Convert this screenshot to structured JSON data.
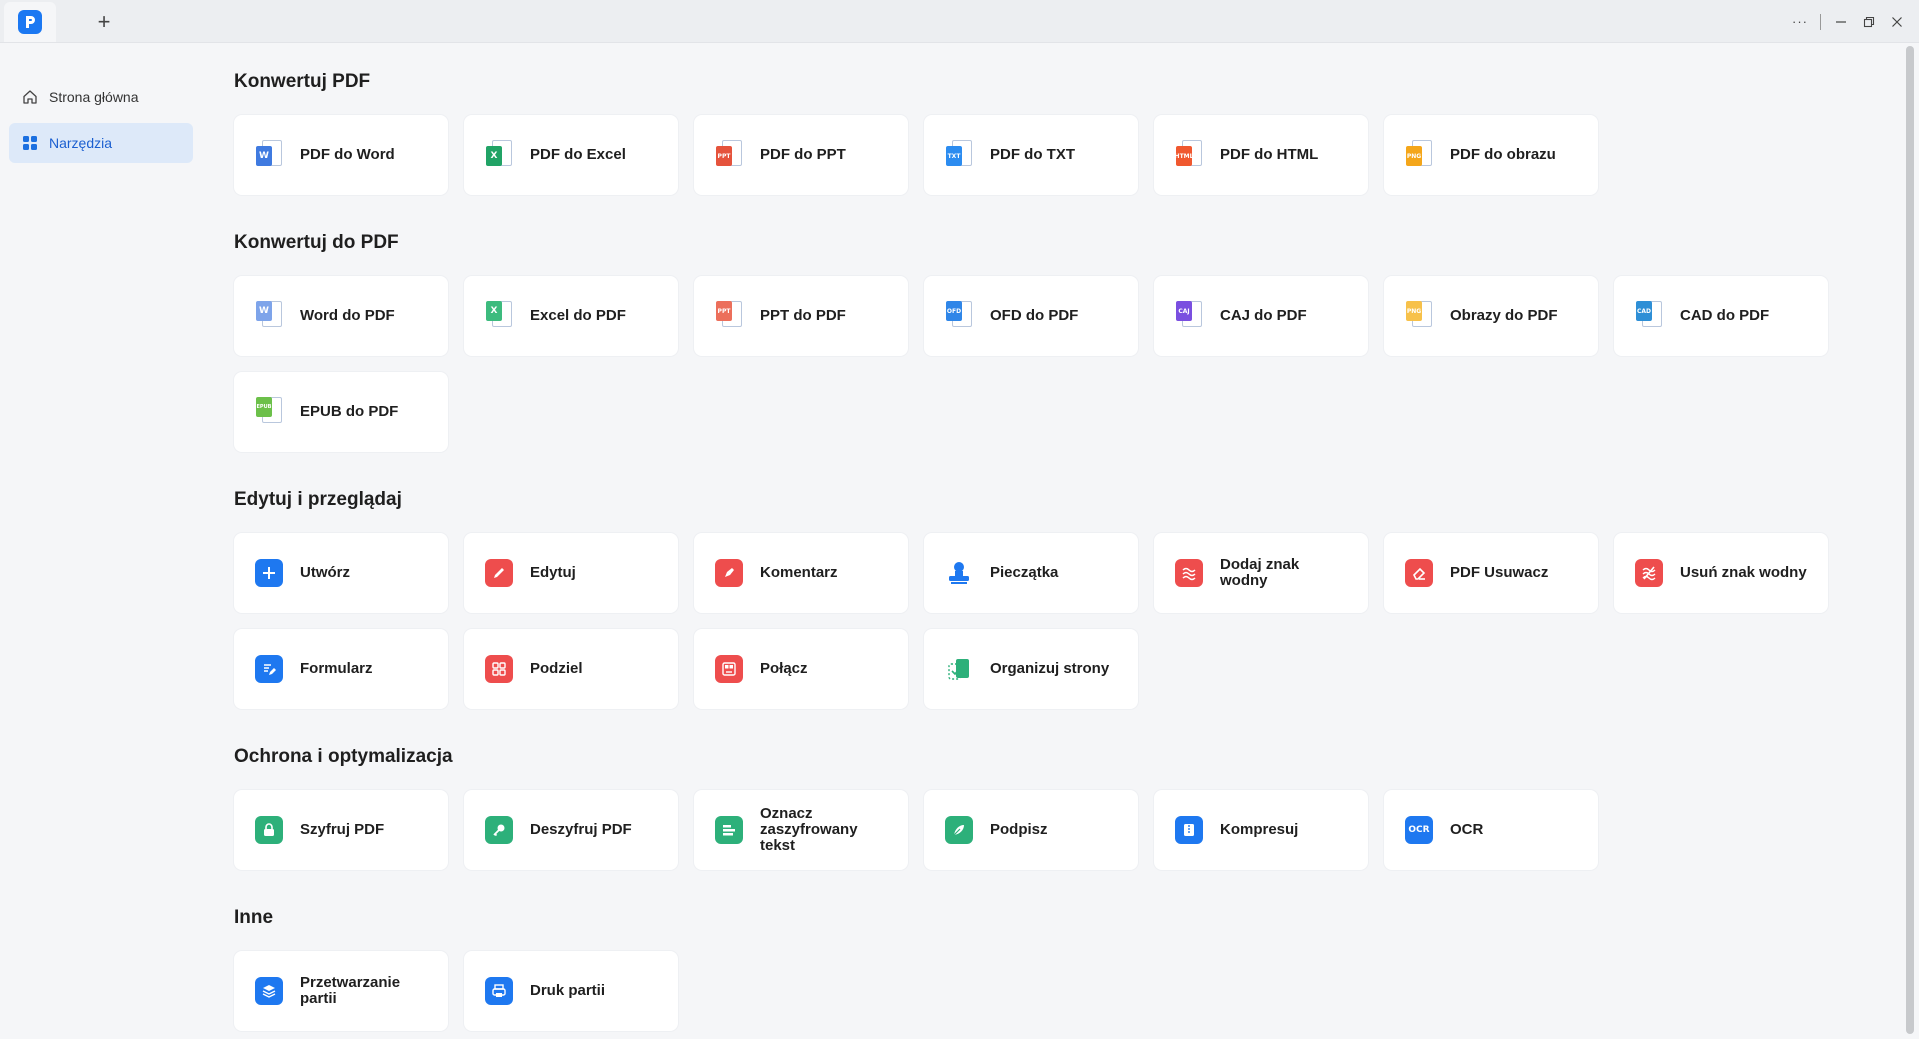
{
  "app": {
    "new_tab_label": "+",
    "window_menu_label": "···"
  },
  "sidebar": {
    "items": [
      {
        "label": "Strona główna",
        "icon": "home-icon",
        "active": false
      },
      {
        "label": "Narzędzia",
        "icon": "grid-icon",
        "active": true
      }
    ]
  },
  "sections": [
    {
      "title": "Konwertuj PDF"
    },
    {
      "title": "Konwertuj do PDF"
    },
    {
      "title": "Edytuj i przeglądaj"
    },
    {
      "title": "Ochrona i optymalizacja"
    },
    {
      "title": "Inne"
    }
  ],
  "tools": {
    "pdf_to_word": "PDF do Word",
    "pdf_to_excel": "PDF do Excel",
    "pdf_to_ppt": "PDF do PPT",
    "pdf_to_txt": "PDF do TXT",
    "pdf_to_html": "PDF do HTML",
    "pdf_to_image": "PDF do obrazu",
    "word_to_pdf": "Word do PDF",
    "excel_to_pdf": "Excel do PDF",
    "ppt_to_pdf": "PPT do PDF",
    "ofd_to_pdf": "OFD do PDF",
    "caj_to_pdf": "CAJ do PDF",
    "images_to_pdf": "Obrazy do PDF",
    "cad_to_pdf": "CAD do PDF",
    "epub_to_pdf": "EPUB do PDF",
    "create": "Utwórz",
    "edit": "Edytuj",
    "comment": "Komentarz",
    "stamp": "Pieczątka",
    "add_watermark": "Dodaj znak wodny",
    "pdf_eraser": "PDF Usuwacz",
    "remove_watermark": "Usuń znak wodny",
    "form": "Formularz",
    "split": "Podziel",
    "merge": "Połącz",
    "organize_pages": "Organizuj strony",
    "encrypt_pdf": "Szyfruj PDF",
    "decrypt_pdf": "Deszyfruj PDF",
    "mark_encrypted_text": "Oznacz zaszyfrowany tekst",
    "sign": "Podpisz",
    "compress": "Kompresuj",
    "ocr": "OCR",
    "batch_processing": "Przetwarzanie partii",
    "batch_print": "Druk partii"
  },
  "badges": {
    "word": "W",
    "excel": "X",
    "ppt": "PPT",
    "txt": "TXT",
    "html": "HTML",
    "png": "PNG",
    "ofd": "OFD",
    "caj": "CAJ",
    "cad": "CAD",
    "epub": "EPUB",
    "ocr": "OCR"
  },
  "colors": {
    "accent": "#1b78f2",
    "word": "#3f7ae0",
    "excel": "#21a366",
    "ppt": "#e5533c",
    "txt": "#2c8cf0",
    "html": "#f0582f",
    "png": "#f4a61a",
    "ofd": "#2f86e8",
    "caj": "#7a4fe0",
    "cad": "#2e8fd6",
    "epub": "#6cc04a",
    "red_tool": "#ee4d4d",
    "blue_tool": "#1e78f0",
    "green_tool": "#2db07a"
  }
}
